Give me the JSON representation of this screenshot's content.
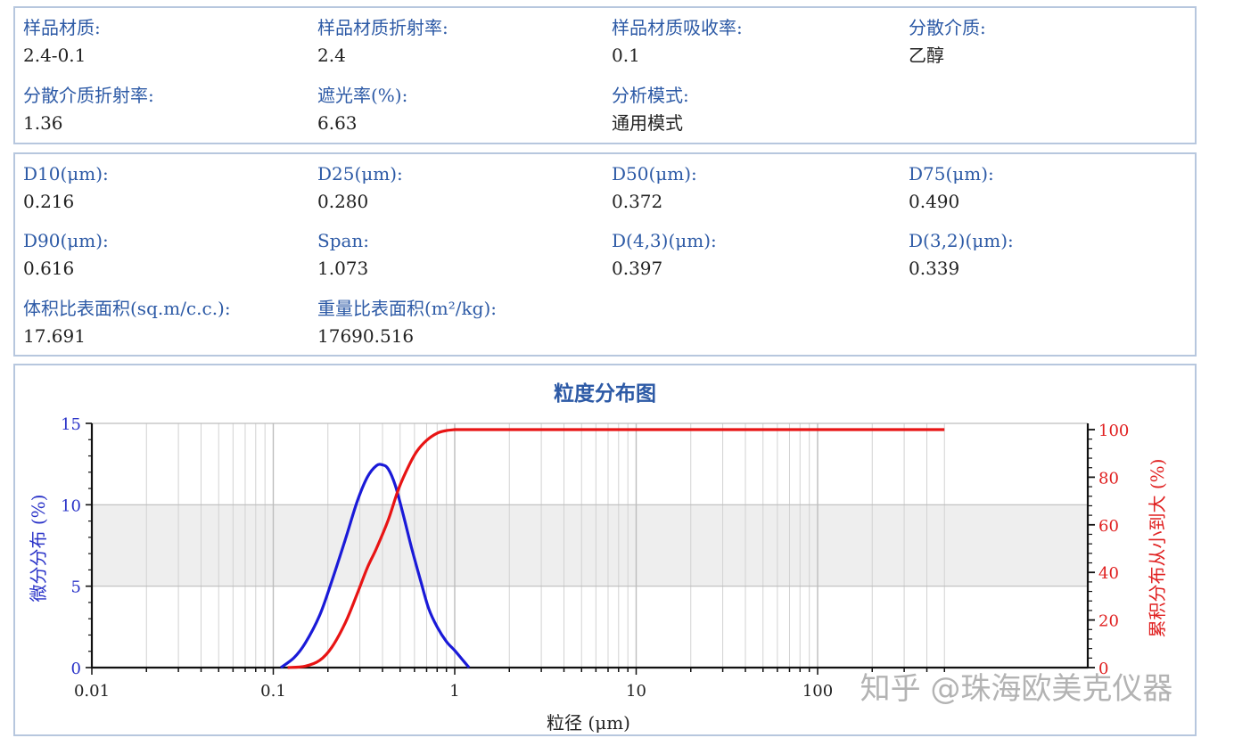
{
  "sample_info": [
    {
      "label": "样品材质:",
      "value": "2.4-0.1"
    },
    {
      "label": "样品材质折射率:",
      "value": "2.4"
    },
    {
      "label": "样品材质吸收率:",
      "value": "0.1"
    },
    {
      "label": "分散介质:",
      "value": "乙醇"
    },
    {
      "label": "分散介质折射率:",
      "value": "1.36"
    },
    {
      "label": "遮光率(%):",
      "value": "6.63"
    },
    {
      "label": "分析模式:",
      "value": "通用模式"
    }
  ],
  "results": [
    {
      "label": "D10(μm):",
      "value": "0.216"
    },
    {
      "label": "D25(μm):",
      "value": "0.280"
    },
    {
      "label": "D50(μm):",
      "value": "0.372"
    },
    {
      "label": "D75(μm):",
      "value": "0.490"
    },
    {
      "label": "D90(μm):",
      "value": "0.616"
    },
    {
      "label": "Span:",
      "value": "1.073"
    },
    {
      "label": "D(4,3)(μm):",
      "value": "0.397"
    },
    {
      "label": "D(3,2)(μm):",
      "value": "0.339"
    },
    {
      "label": "体积比表面积(sq.m/c.c.):",
      "value": "17.691"
    },
    {
      "label": "重量比表面积(m²/kg):",
      "value": "17690.516"
    }
  ],
  "watermark": "知乎 @珠海欧美克仪器",
  "chart_data": {
    "type": "line",
    "title": "粒度分布图",
    "xlabel": "粒径 (μm)",
    "ylabel": "微分分布 (%)",
    "y2label": "累积分布从小到大 (%)",
    "x_scale": "log",
    "xlim": [
      0.01,
      500
    ],
    "ylim": [
      0,
      15
    ],
    "y2lim": [
      0,
      100
    ],
    "x_ticks": [
      "0.01",
      "0.1",
      "1",
      "10",
      "100"
    ],
    "y_ticks": [
      "0",
      "5",
      "10",
      "15"
    ],
    "y2_ticks": [
      "0",
      "20",
      "40",
      "60",
      "80",
      "100"
    ],
    "grid": true,
    "shaded_band": [
      5,
      10
    ],
    "colors": {
      "differential": "#1a1ad8",
      "cumulative": "#e81414"
    },
    "series": [
      {
        "axis": "left",
        "x": [
          0.11,
          0.13,
          0.15,
          0.18,
          0.21,
          0.25,
          0.29,
          0.33,
          0.37,
          0.4,
          0.43,
          0.47,
          0.52,
          0.58,
          0.65,
          0.72,
          0.8,
          0.9,
          1.0,
          1.1,
          1.2
        ],
        "values": [
          0.0,
          0.6,
          1.5,
          3.2,
          5.3,
          7.9,
          10.2,
          11.7,
          12.4,
          12.45,
          12.2,
          11.2,
          9.4,
          7.3,
          5.3,
          3.6,
          2.5,
          1.6,
          1.05,
          0.5,
          0.0
        ]
      },
      {
        "axis": "right",
        "x": [
          0.12,
          0.15,
          0.18,
          0.21,
          0.25,
          0.29,
          0.33,
          0.37,
          0.43,
          0.49,
          0.56,
          0.62,
          0.7,
          0.8,
          0.9,
          1.0,
          500
        ],
        "values": [
          0,
          0.6,
          3,
          8.5,
          19,
          31,
          42,
          50,
          62,
          75,
          85,
          91,
          95.5,
          98.5,
          99.6,
          100,
          100
        ]
      }
    ]
  }
}
